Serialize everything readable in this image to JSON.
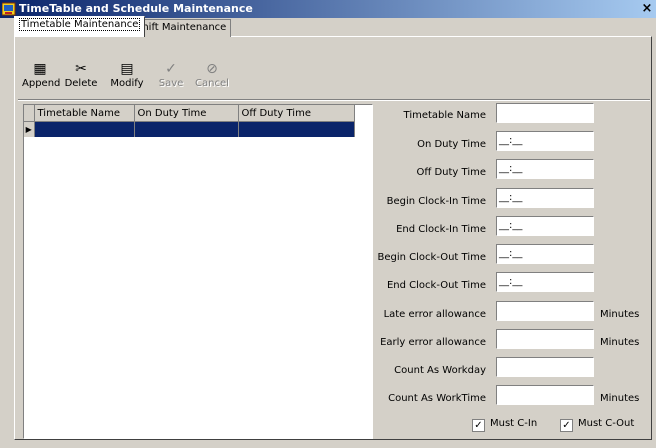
{
  "window": {
    "title": "TimeTable and Schedule Maintenance",
    "close": "×"
  },
  "tabs": [
    {
      "label": "Timetable Maintenance",
      "active": true
    },
    {
      "label": "Shift Maintenance",
      "active": false
    }
  ],
  "toolbar": {
    "append": {
      "label": "Append",
      "icon": "append-icon",
      "glyph": "▦"
    },
    "delete": {
      "label": "Delete",
      "icon": "delete-icon",
      "glyph": "✂"
    },
    "modify": {
      "label": "Modify",
      "icon": "modify-icon",
      "glyph": "▤"
    },
    "save": {
      "label": "Save",
      "icon": "save-checkmark-icon",
      "glyph": "✓"
    },
    "cancel": {
      "label": "Cancel",
      "icon": "cancel-icon",
      "glyph": "⊘"
    }
  },
  "grid": {
    "columns": [
      "Timetable Name",
      "On Duty Time",
      "Off Duty Time"
    ],
    "row_indicator": "▶"
  },
  "form": {
    "timetable_name": {
      "label": "Timetable Name",
      "value": ""
    },
    "on_duty_time": {
      "label": "On Duty Time",
      "value": "__:__"
    },
    "off_duty_time": {
      "label": "Off Duty Time",
      "value": "__:__"
    },
    "begin_clock_in": {
      "label": "Begin Clock-In Time",
      "value": "__:__"
    },
    "end_clock_in": {
      "label": "End Clock-In Time",
      "value": "__:__"
    },
    "begin_clock_out": {
      "label": "Begin Clock-Out Time",
      "value": "__:__"
    },
    "end_clock_out": {
      "label": "End Clock-Out Time",
      "value": "__:__"
    },
    "late_allowance": {
      "label": "Late error allowance",
      "value": "",
      "units": "Minutes"
    },
    "early_allowance": {
      "label": "Early error allowance",
      "value": "",
      "units": "Minutes"
    },
    "count_workday": {
      "label": "Count As Workday",
      "value": ""
    },
    "count_worktime": {
      "label": "Count As WorkTime",
      "value": "",
      "units": "Minutes"
    }
  },
  "checkboxes": {
    "must_cin": {
      "label": "Must C-In",
      "checked": true,
      "mark": "✓"
    },
    "must_cout": {
      "label": "Must C-Out",
      "checked": true,
      "mark": "✓"
    }
  }
}
